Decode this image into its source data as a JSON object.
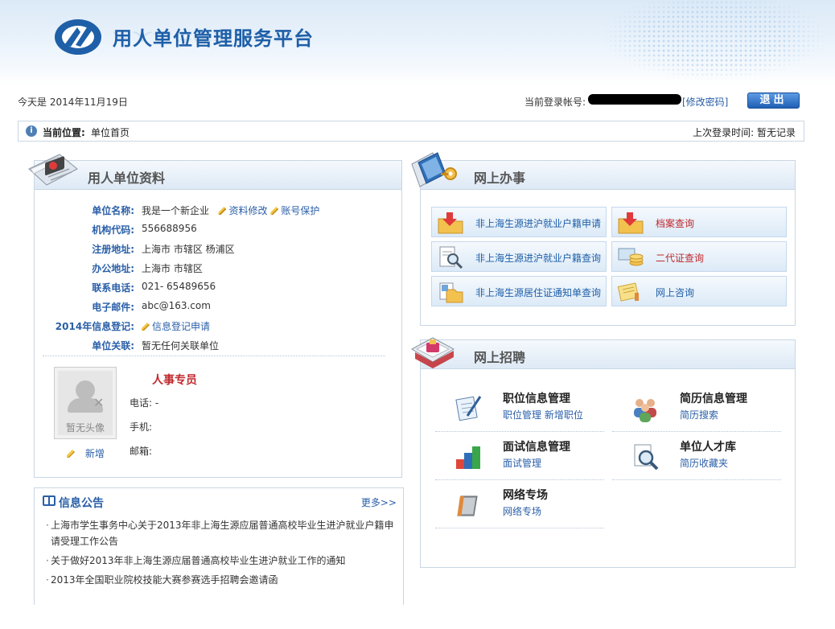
{
  "header": {
    "site_title": "用人单位管理服务平台"
  },
  "topbar": {
    "today": "今天是 2014年11月19日",
    "account_label": "当前登录帐号:",
    "change_password": "[修改密码]",
    "logout": "退出"
  },
  "location": {
    "label": "当前位置:",
    "value": "单位首页",
    "last_login": "上次登录时间:    暂无记录"
  },
  "company": {
    "title": "用人单位资料",
    "rows": [
      {
        "label": "单位名称:",
        "value": "我是一个新企业"
      },
      {
        "label": "机构代码:",
        "value": "556688956"
      },
      {
        "label": "注册地址:",
        "value": "上海市 市辖区 杨浦区"
      },
      {
        "label": "办公地址:",
        "value": "上海市 市辖区"
      },
      {
        "label": "联系电话:",
        "value": "021- 65489656"
      },
      {
        "label": "电子邮件:",
        "value": "abc@163.com"
      },
      {
        "label": "2014年信息登记:",
        "value": ""
      },
      {
        "label": "单位关联:",
        "value": "暂无任何关联单位"
      }
    ],
    "edit_info": "资料修改",
    "account_protect": "账号保护",
    "register_apply": "信息登记申请",
    "avatar_text": "暂无头像",
    "add_link": "新增",
    "hr": {
      "title": "人事专员",
      "phone": "电话: -",
      "mobile": "手机:",
      "email": "邮箱:"
    }
  },
  "notices": {
    "title": "信息公告",
    "more": "更多>>",
    "items": [
      "上海市学生事务中心关于2013年非上海生源应届普通高校毕业生进沪就业户籍申请受理工作公告",
      "关于做好2013年非上海生源应届普通高校毕业生进沪就业工作的通知",
      "2013年全国职业院校技能大赛参赛选手招聘会邀请函"
    ]
  },
  "services": {
    "title": "网上办事",
    "items": [
      {
        "label": "非上海生源进沪就业户籍申请",
        "color": "#1e5fa8"
      },
      {
        "label": "档案查询",
        "color": "#c0282d"
      },
      {
        "label": "非上海生源进沪就业户籍查询",
        "color": "#1e5fa8"
      },
      {
        "label": "二代证查询",
        "color": "#c0282d"
      },
      {
        "label": "非上海生源居住证通知单查询",
        "color": "#1e5fa8"
      },
      {
        "label": "网上咨询",
        "color": "#1e5fa8"
      }
    ]
  },
  "recruit": {
    "title": "网上招聘",
    "cells": [
      {
        "title": "职位信息管理",
        "links": [
          "职位管理",
          "新增职位"
        ],
        "icon": "pen-document-icon"
      },
      {
        "title": "简历信息管理",
        "links": [
          "简历搜索"
        ],
        "icon": "people-icon"
      },
      {
        "title": "面试信息管理",
        "links": [
          "面试管理"
        ],
        "icon": "blocks-icon"
      },
      {
        "title": "单位人才库",
        "links": [
          "简历收藏夹"
        ],
        "icon": "magnifier-icon"
      },
      {
        "title": "网络专场",
        "links": [
          "网络专场"
        ],
        "icon": "card-icon"
      }
    ]
  }
}
